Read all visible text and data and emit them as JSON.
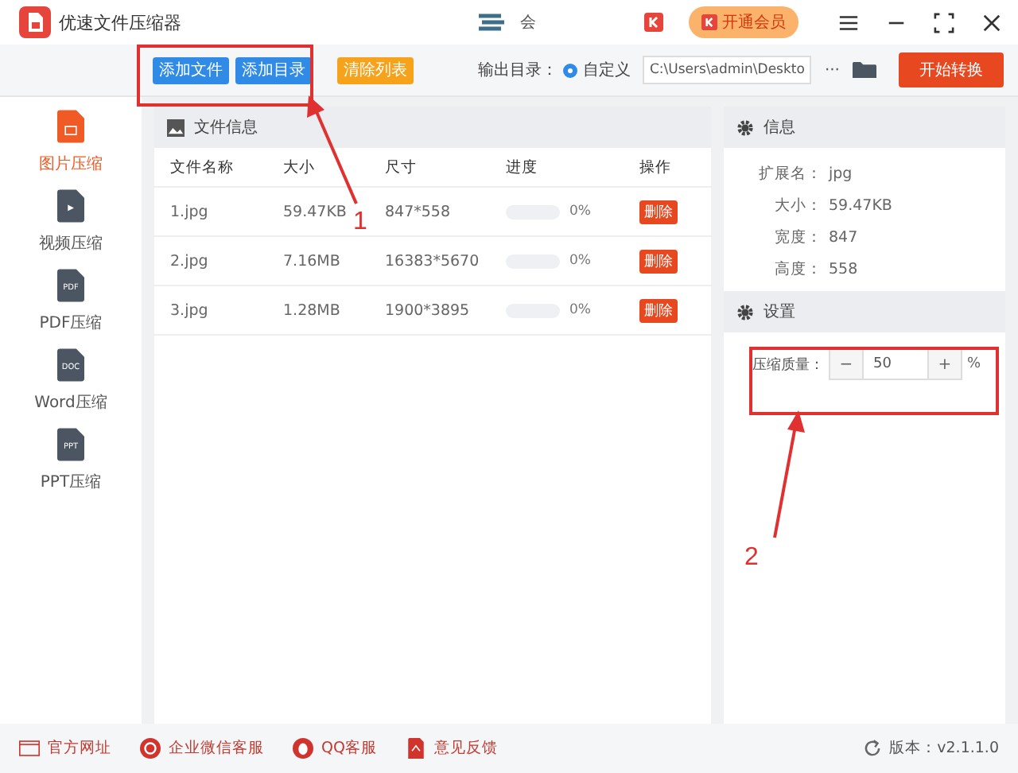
{
  "window": {
    "title": "优速文件压缩器",
    "user_label": "会",
    "vip_button": "开通会员"
  },
  "toolbar": {
    "buttons": [
      {
        "label": "添加文件",
        "kind": "primary"
      },
      {
        "label": "添加目录",
        "kind": "primary"
      },
      {
        "label": "清除列表",
        "kind": "warning"
      }
    ],
    "output_label": "输出目录：",
    "radio": {
      "label": "自定义",
      "selected": true
    },
    "path": "C:\\Users\\admin\\Deskto",
    "more": "···",
    "start_button": "开始转换"
  },
  "sidebar": {
    "items": [
      {
        "label": "图片压缩",
        "selected": true
      },
      {
        "label": "视频压缩",
        "badge": "▶",
        "selected": false
      },
      {
        "label": "PDF压缩",
        "badge": "PDF",
        "selected": false
      },
      {
        "label": "Word压缩",
        "badge": "DOC",
        "selected": false
      },
      {
        "label": "PPT压缩",
        "badge": "PPT",
        "selected": false
      }
    ]
  },
  "file_panel": {
    "title": "文件信息",
    "columns": [
      "文件名称",
      "大小",
      "尺寸",
      "进度",
      "操作"
    ],
    "rows": [
      {
        "name": "1.jpg",
        "size": "59.47KB",
        "dims": "847*558",
        "level": 0,
        "percent": "0%",
        "action": "删除"
      },
      {
        "name": "2.jpg",
        "size": "7.16MB",
        "dims": "16383*5670",
        "level": 0,
        "percent": "0%",
        "action": "删除"
      },
      {
        "name": "3.jpg",
        "size": "1.28MB",
        "dims": "1900*3895",
        "level": 0,
        "percent": "0%",
        "action": "删除"
      }
    ]
  },
  "info_panel": {
    "title": "信息",
    "fields": [
      {
        "label": "扩展名：",
        "value": "jpg"
      },
      {
        "label": "大小：",
        "value": "59.47KB"
      },
      {
        "label": "宽度：",
        "value": "847"
      },
      {
        "label": "高度：",
        "value": "558"
      }
    ]
  },
  "settings_panel": {
    "title": "设置",
    "quality_label": "压缩质量：",
    "minus": "−",
    "value": "50",
    "plus": "+",
    "unit": "%"
  },
  "annotations": [
    {
      "number": "1"
    },
    {
      "number": "2"
    }
  ],
  "footer": {
    "links": [
      {
        "label": "官方网址",
        "kind": "web"
      },
      {
        "label": "企业微信客服",
        "kind": "chat"
      },
      {
        "label": "QQ客服",
        "kind": "qq"
      },
      {
        "label": "意见反馈",
        "kind": "feedback"
      }
    ],
    "version": "版本：v2.1.1.0"
  }
}
